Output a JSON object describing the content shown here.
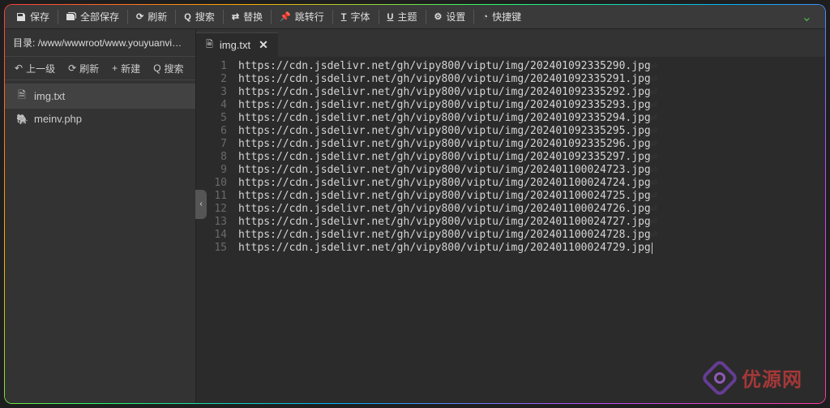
{
  "toolbar": {
    "save": "保存",
    "save_all": "全部保存",
    "refresh": "刷新",
    "search": "搜索",
    "replace": "替换",
    "goto": "跳转行",
    "font": "字体",
    "theme": "主题",
    "settings": "设置",
    "shortcuts": "快捷键"
  },
  "sidebar": {
    "breadcrumb_label": "目录:",
    "breadcrumb_path": "/www/wwwroot/www.youyuanvi…",
    "actions": {
      "up": "上一级",
      "refresh": "刷新",
      "new": "新建",
      "search": "搜索"
    },
    "files": [
      {
        "icon": "file",
        "name": "img.txt",
        "active": true
      },
      {
        "icon": "php",
        "name": "meinv.php",
        "active": false
      }
    ]
  },
  "tab": {
    "icon": "file",
    "name": "img.txt"
  },
  "code_lines": [
    "https://cdn.jsdelivr.net/gh/vipy800/viptu/img/202401092335290.jpg",
    "https://cdn.jsdelivr.net/gh/vipy800/viptu/img/202401092335291.jpg",
    "https://cdn.jsdelivr.net/gh/vipy800/viptu/img/202401092335292.jpg",
    "https://cdn.jsdelivr.net/gh/vipy800/viptu/img/202401092335293.jpg",
    "https://cdn.jsdelivr.net/gh/vipy800/viptu/img/202401092335294.jpg",
    "https://cdn.jsdelivr.net/gh/vipy800/viptu/img/202401092335295.jpg",
    "https://cdn.jsdelivr.net/gh/vipy800/viptu/img/202401092335296.jpg",
    "https://cdn.jsdelivr.net/gh/vipy800/viptu/img/202401092335297.jpg",
    "https://cdn.jsdelivr.net/gh/vipy800/viptu/img/202401100024723.jpg",
    "https://cdn.jsdelivr.net/gh/vipy800/viptu/img/202401100024724.jpg",
    "https://cdn.jsdelivr.net/gh/vipy800/viptu/img/202401100024725.jpg",
    "https://cdn.jsdelivr.net/gh/vipy800/viptu/img/202401100024726.jpg",
    "https://cdn.jsdelivr.net/gh/vipy800/viptu/img/202401100024727.jpg",
    "https://cdn.jsdelivr.net/gh/vipy800/viptu/img/202401100024728.jpg",
    "https://cdn.jsdelivr.net/gh/vipy800/viptu/img/202401100024729.jpg"
  ],
  "watermark": {
    "text": "优源网"
  },
  "icons": {
    "save": "💾",
    "save_all": "folder-save",
    "refresh": "↻",
    "search": "🔍",
    "replace": "⇄",
    "goto": "📌",
    "font_mark": "T",
    "theme_mark": "U",
    "settings": "⚙",
    "shortcuts": "⏱",
    "chevron_down": "⌄",
    "arrow_up": "↶",
    "plus": "+",
    "file": "📄",
    "php": "🐘",
    "close": "✕",
    "chevron_left": "‹"
  }
}
